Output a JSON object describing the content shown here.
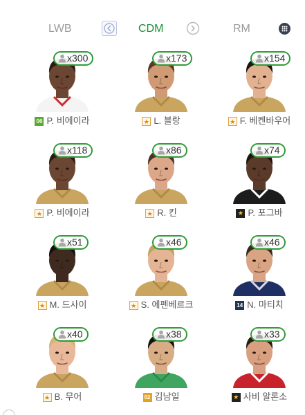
{
  "position_nav": {
    "prev_position": "LWB",
    "current_position": "CDM",
    "next_position": "RM",
    "prev_icon": "chevron-left-icon",
    "next_icon": "chevron-right-icon",
    "menu_icon": "grid-menu-icon",
    "accent_color": "#1a8f33"
  },
  "players": [
    {
      "count": "x300",
      "name": "P. 비에이라",
      "season_badge": "06",
      "season_style": "season-06",
      "skin": "#6b4632",
      "hair": "#2a1c14",
      "kit": "white"
    },
    {
      "count": "x173",
      "name": "L. 블랑",
      "season_badge": "★",
      "season_style": "season-star",
      "skin": "#d09a74",
      "hair": "#5a3a22",
      "kit": "gold"
    },
    {
      "count": "x154",
      "name": "F. 베켄바우어",
      "season_badge": "★",
      "season_style": "season-star",
      "skin": "#e2b290",
      "hair": "#1c140e",
      "kit": "gold"
    },
    {
      "count": "x118",
      "name": "P. 비에이라",
      "season_badge": "★",
      "season_style": "season-star",
      "skin": "#6b4632",
      "hair": "#2a1c14",
      "kit": "gold"
    },
    {
      "count": "x86",
      "name": "R. 킨",
      "season_badge": "★",
      "season_style": "season-star",
      "skin": "#dca688",
      "hair": "#4a3222",
      "kit": "gold"
    },
    {
      "count": "x74",
      "name": "P. 포그바",
      "season_badge": "★",
      "season_style": "season-star-dark",
      "skin": "#5a3a28",
      "hair": "#1c1410",
      "kit": "black"
    },
    {
      "count": "x51",
      "name": "M. 드사이",
      "season_badge": "★",
      "season_style": "season-star",
      "skin": "#3e2a1e",
      "hair": "#16100c",
      "kit": "gold"
    },
    {
      "count": "x46",
      "name": "S. 에펜베르크",
      "season_badge": "★",
      "season_style": "season-star",
      "skin": "#e4b494",
      "hair": "#c2a060",
      "kit": "gold"
    },
    {
      "count": "x46",
      "name": "N. 마티치",
      "season_badge": "14",
      "season_style": "season-14",
      "skin": "#d8a484",
      "hair": "#3a2a1c",
      "kit": "navy"
    },
    {
      "count": "x40",
      "name": "B. 무어",
      "season_badge": "★",
      "season_style": "season-star",
      "skin": "#e8b898",
      "hair": "#d4b478",
      "kit": "gold"
    },
    {
      "count": "x38",
      "name": "김남일",
      "season_badge": "02",
      "season_style": "season-02",
      "skin": "#d8ac84",
      "hair": "#16120e",
      "kit": "green"
    },
    {
      "count": "x33",
      "name": "사비 알론소",
      "season_badge": "★",
      "season_style": "season-star-dark",
      "skin": "#d8a080",
      "hair": "#2a1c12",
      "kit": "red"
    }
  ]
}
